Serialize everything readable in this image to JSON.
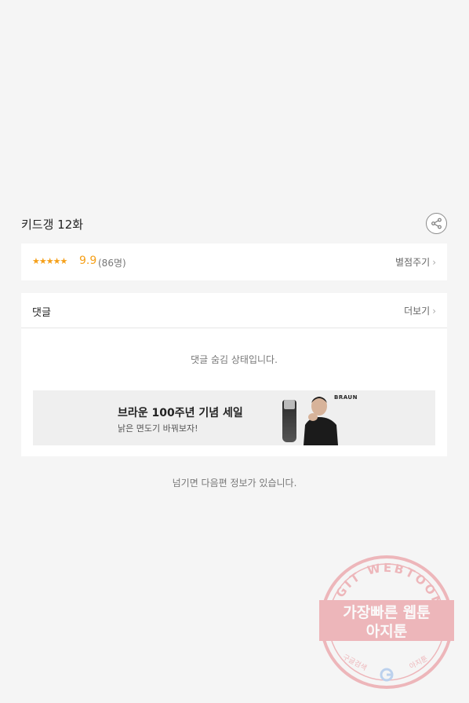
{
  "episode": {
    "title": "키드갱 12화"
  },
  "rating": {
    "stars": "★★★★★",
    "score": "9.9",
    "count": "(86명)",
    "rate_link": "별점주기"
  },
  "comments": {
    "title": "댓글",
    "more_link": "더보기",
    "hidden_message": "댓글 숨김 상태입니다."
  },
  "ad": {
    "title": "브라운 100주년 기념 세일",
    "subtitle": "낡은 면도기 바꿔보자!",
    "brand": "BRAUN"
  },
  "next_info": "넘기면 다음편 정보가 있습니다.",
  "watermark": {
    "arc_text": "AGIT WEBTOON",
    "line1": "가장빠른 웹툰",
    "line2": "아지툰",
    "bottom_left": "구글검색",
    "bottom_right": "아지툰"
  },
  "icons": {
    "share": "share-icon",
    "chevron": "chevron-right-icon",
    "google": "google-g-icon"
  },
  "colors": {
    "background": "#f5f5f5",
    "star": "#f5a01a",
    "watermark": "#e8838a"
  }
}
